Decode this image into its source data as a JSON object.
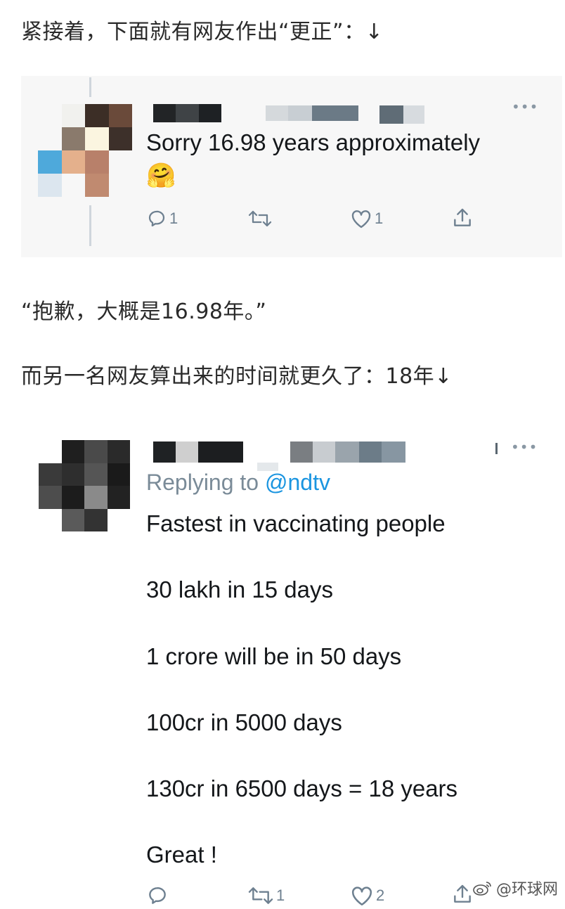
{
  "article": {
    "intro_text": "紧接着，下面就有网友作出“更正”：↓",
    "translation_text": "“抱歉，大概是16.98年。”",
    "second_intro_text": "而另一名网友算出来的时间就更久了：18年↓"
  },
  "tweet1": {
    "text": "Sorry 16.98 years approximately",
    "emoji": "🤗",
    "more_icon": "more-horizontal-icon",
    "actions": {
      "reply_count": "1",
      "retweet_count": "",
      "like_count": "1"
    }
  },
  "tweet2": {
    "reply_prefix": "Replying to ",
    "reply_handle": "@ndtv",
    "lines": [
      "Fastest in vaccinating people",
      "30 lakh in 15 days",
      "1 crore will be in 50 days",
      "100cr in 5000 days",
      "130cr in 6500 days = 18 years",
      "Great !"
    ],
    "more_icon": "more-horizontal-icon",
    "actions": {
      "reply_count": "",
      "retweet_count": "1",
      "like_count": "2"
    }
  },
  "watermark": {
    "text": "@环球网",
    "icon": "weibo-icon"
  },
  "colors": {
    "link_blue": "#1b95e0",
    "icon_gray": "#6e8090",
    "card_background": "#f7f7f7"
  }
}
